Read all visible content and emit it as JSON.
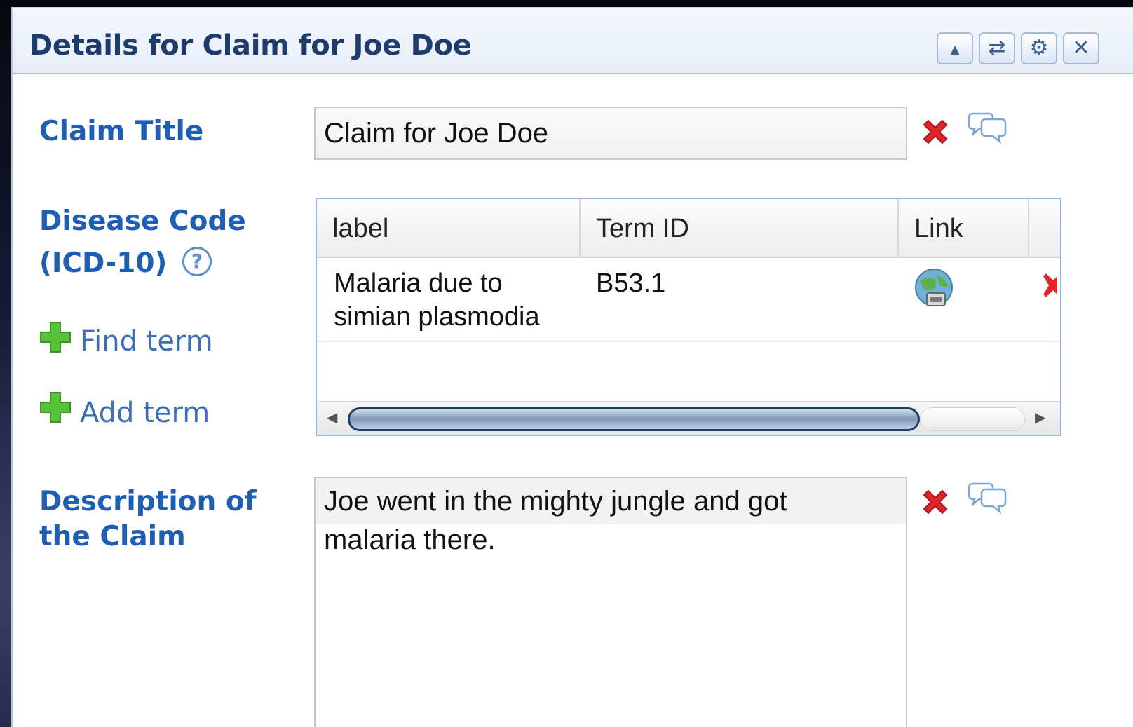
{
  "window": {
    "title": "Details for Claim for Joe Doe",
    "toolbar": [
      {
        "icon": "collapse-up-icon",
        "glyph": "▲"
      },
      {
        "icon": "refresh-icon",
        "glyph": "⇄"
      },
      {
        "icon": "gear-icon",
        "glyph": "⚙"
      },
      {
        "icon": "close-icon",
        "glyph": "✕"
      }
    ]
  },
  "claim_title": {
    "label": "Claim Title",
    "value": "Claim for Joe Doe"
  },
  "disease_code": {
    "label_line1": "Disease Code",
    "label_line2": "(ICD-10)",
    "help_glyph": "?",
    "find_term": "Find term",
    "add_term": "Add term",
    "table": {
      "columns": [
        "label",
        "Term ID",
        "Link"
      ],
      "rows": [
        {
          "label_line1": "Malaria due to",
          "label_line2": "simian plasmodia",
          "term_id": "B53.1"
        }
      ]
    }
  },
  "description": {
    "label_line1": "Description of",
    "label_line2": "the Claim",
    "value_line1": "Joe went in the mighty jungle and got",
    "value_line2": "malaria there."
  },
  "colors": {
    "label_blue": "#1f5fb3",
    "title_navy": "#1d3c6d",
    "delete_red": "#e0262b",
    "plus_green": "#56c23a"
  }
}
